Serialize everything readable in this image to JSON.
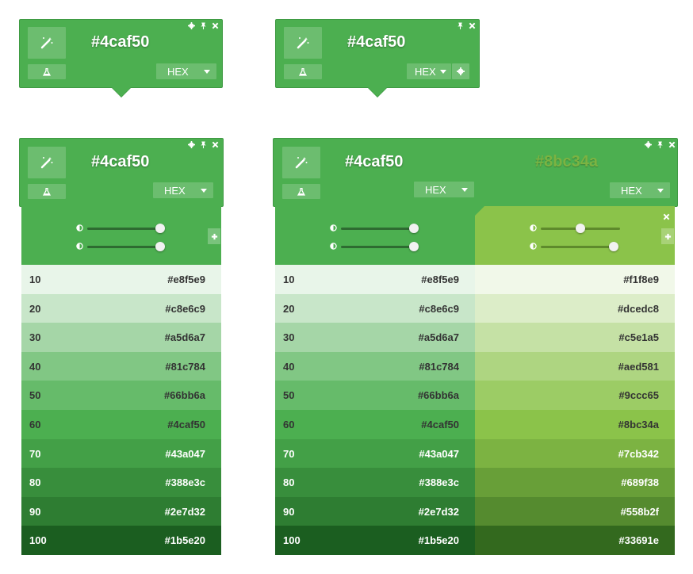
{
  "primary_hex": "#4caf50",
  "secondary_hex": "#8bc34a",
  "format_label": "HEX",
  "colors": {
    "primary": "#4caf50",
    "secondary": "#8bc34a"
  },
  "icons": {
    "wand": "magic-wand-icon",
    "flask": "flask-icon",
    "gear": "gear-icon",
    "pin": "pin-icon",
    "close": "close-icon",
    "contrast": "contrast-icon",
    "add": "plus-icon"
  },
  "steps": [
    "10",
    "20",
    "30",
    "40",
    "50",
    "60",
    "70",
    "80",
    "90",
    "100"
  ],
  "primary_shades": [
    "#e8f5e9",
    "#c8e6c9",
    "#a5d6a7",
    "#81c784",
    "#66bb6a",
    "#4caf50",
    "#43a047",
    "#388e3c",
    "#2e7d32",
    "#1b5e20"
  ],
  "secondary_shades": [
    "#f1f8e9",
    "#dcedc8",
    "#c5e1a5",
    "#aed581",
    "#9ccc65",
    "#8bc34a",
    "#7cb342",
    "#689f38",
    "#558b2f",
    "#33691e"
  ],
  "sliders": {
    "primary": [
      1.0,
      1.0
    ],
    "secondary": [
      0.5,
      1.0
    ]
  }
}
